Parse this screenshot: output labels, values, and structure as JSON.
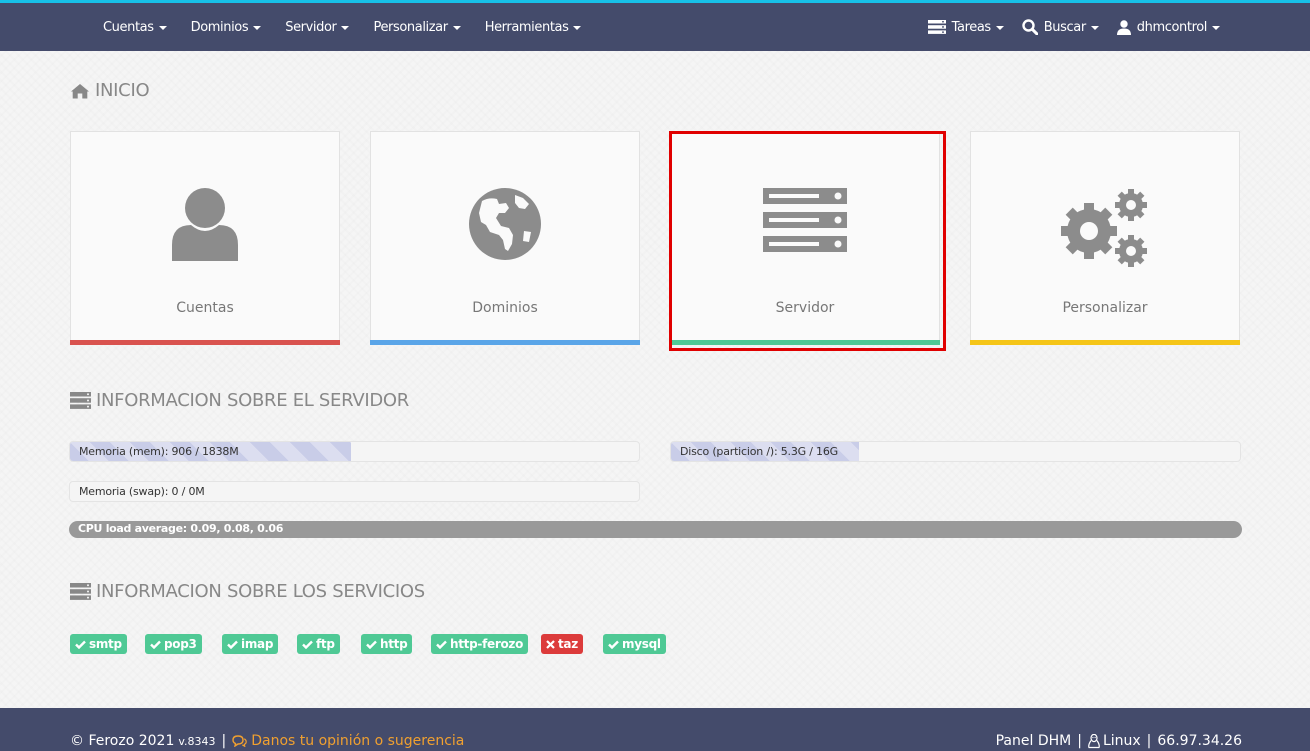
{
  "nav": {
    "left": [
      "Cuentas",
      "Dominios",
      "Servidor",
      "Personalizar",
      "Herramientas"
    ],
    "tasks": "Tareas",
    "search": "Buscar",
    "user": "dhmcontrol"
  },
  "home": {
    "title": "INICIO",
    "cards": [
      {
        "label": "Cuentas",
        "icon": "user-icon",
        "color": "#d9534f"
      },
      {
        "label": "Dominios",
        "icon": "globe-icon",
        "color": "#5aa5e8"
      },
      {
        "label": "Servidor",
        "icon": "server-icon",
        "color": "#4fc995"
      },
      {
        "label": "Personalizar",
        "icon": "gears-icon",
        "color": "#f5c518"
      }
    ]
  },
  "server_info": {
    "title": "INFORMACION SOBRE EL SERVIDOR",
    "memory": {
      "label": "Memoria (mem): 906 / 1838M",
      "used_fraction": 0.493
    },
    "disk": {
      "label": "Disco (particion /): 5.3G / 16G",
      "used_fraction": 0.331
    },
    "swap": {
      "label": "Memoria (swap): 0 / 0M",
      "used_fraction": 0
    },
    "cpu": {
      "label": "CPU load average: 0.09, 0.08, 0.06"
    }
  },
  "services": {
    "title": "INFORMACION SOBRE LOS SERVICIOS",
    "items": [
      {
        "name": "smtp",
        "status": "ok"
      },
      {
        "name": "pop3",
        "status": "ok"
      },
      {
        "name": "imap",
        "status": "ok"
      },
      {
        "name": "ftp",
        "status": "ok"
      },
      {
        "name": "http",
        "status": "ok"
      },
      {
        "name": "http-ferozo",
        "status": "ok"
      },
      {
        "name": "taz",
        "status": "fail"
      },
      {
        "name": "mysql",
        "status": "ok"
      }
    ]
  },
  "footer": {
    "copyright": "© Ferozo 2021",
    "version": "v.8343",
    "feedback": "Danos tu opinión o sugerencia",
    "panel": "Panel DHM",
    "os": "Linux",
    "ip": "66.97.34.26"
  }
}
